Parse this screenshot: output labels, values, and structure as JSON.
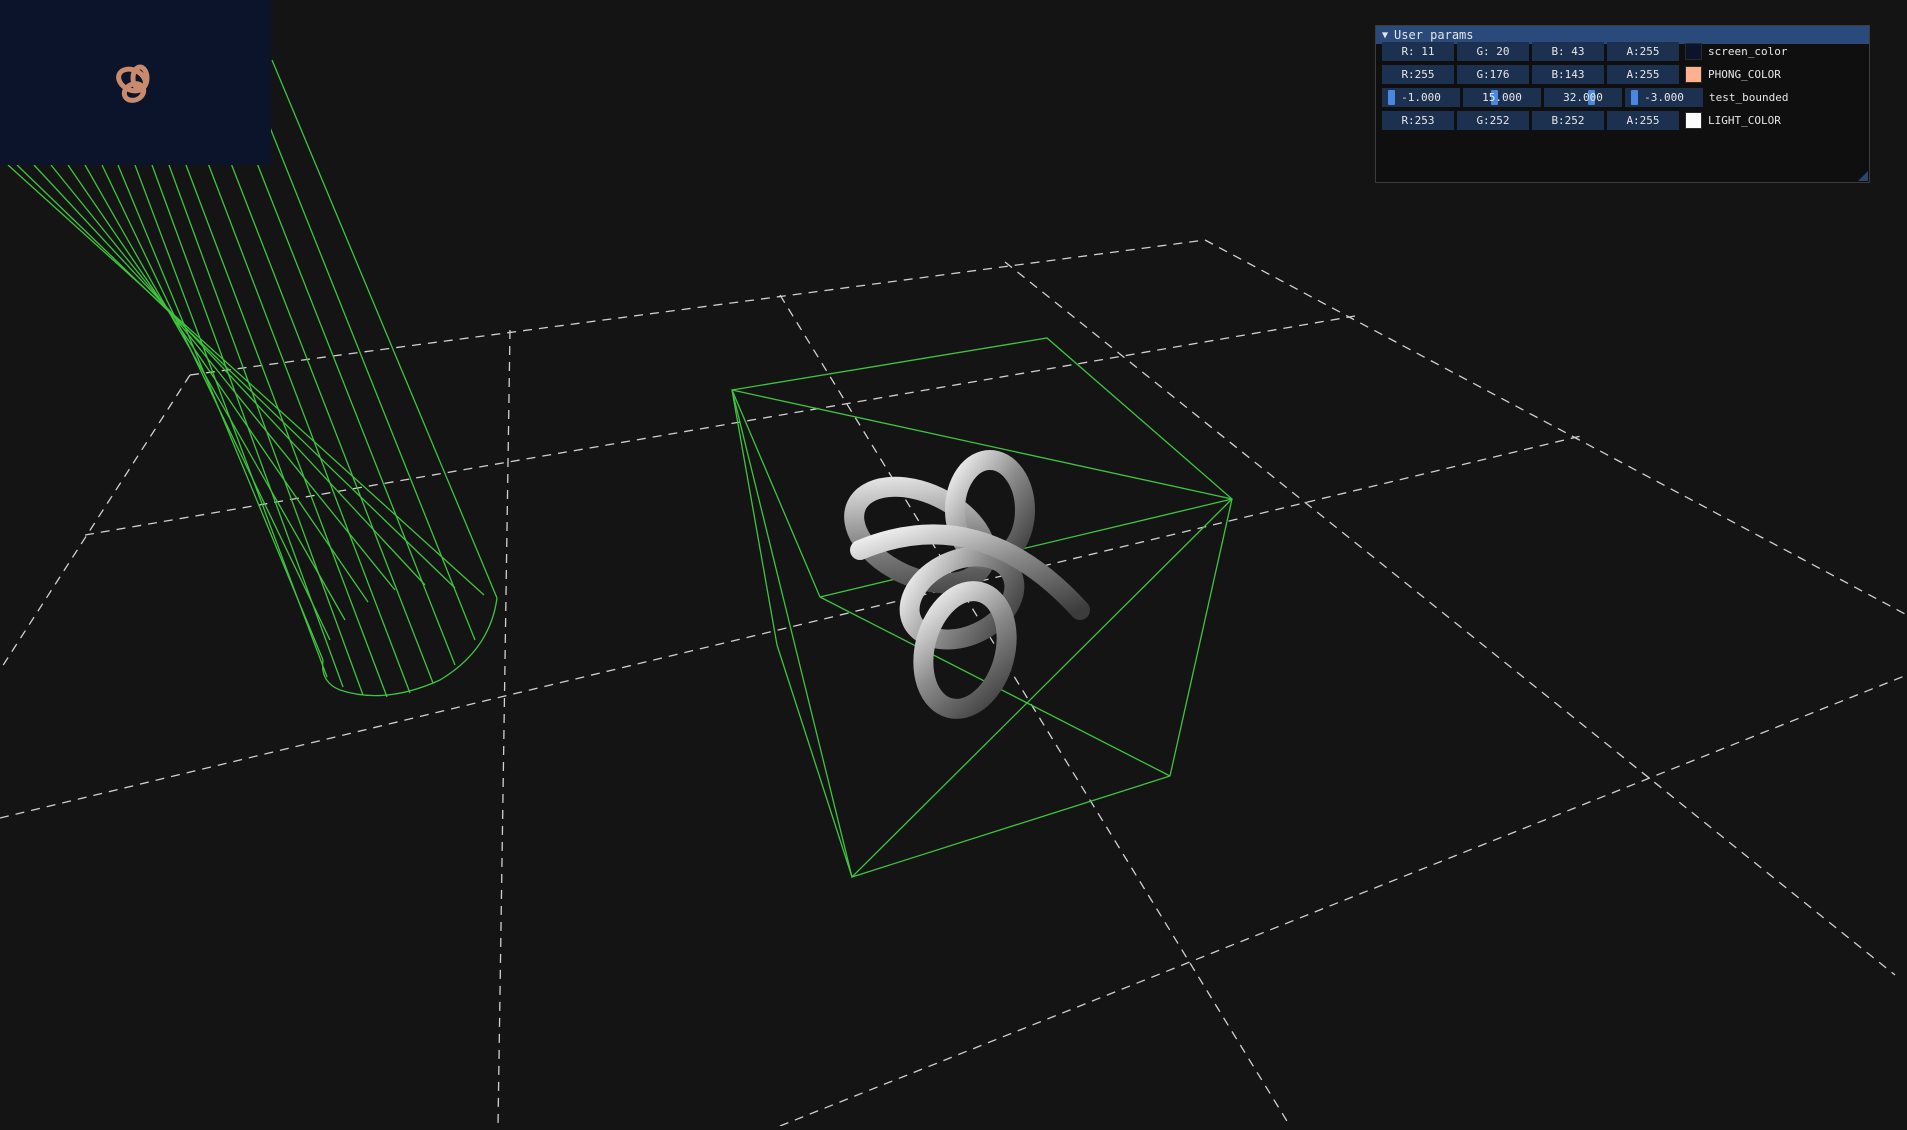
{
  "panel": {
    "title": "User params",
    "rows": [
      {
        "label": "screen_color",
        "swatch": "#0b142b",
        "fields": [
          "R: 11",
          "G: 20",
          "B: 43",
          "A:255"
        ]
      },
      {
        "label": "PHONG_COLOR",
        "swatch": "#ffb08f",
        "fields": [
          "R:255",
          "G:176",
          "B:143",
          "A:255"
        ]
      },
      {
        "label": "test_bounded",
        "swatch": null,
        "fields": [
          "-1.000",
          "15.000",
          "32.000",
          "-3.000"
        ]
      },
      {
        "label": "LIGHT_COLOR",
        "swatch": "#fdfcfc",
        "fields": [
          "R:253",
          "G:252",
          "B:252",
          "A:255"
        ]
      }
    ]
  },
  "colors": {
    "background": "#141414",
    "grid": "#d8d8d8",
    "wireframe": "#3ec43e",
    "panel_title": "#294a7a",
    "field_bg": "#1c3050",
    "slider_grab": "#4a88e0"
  }
}
